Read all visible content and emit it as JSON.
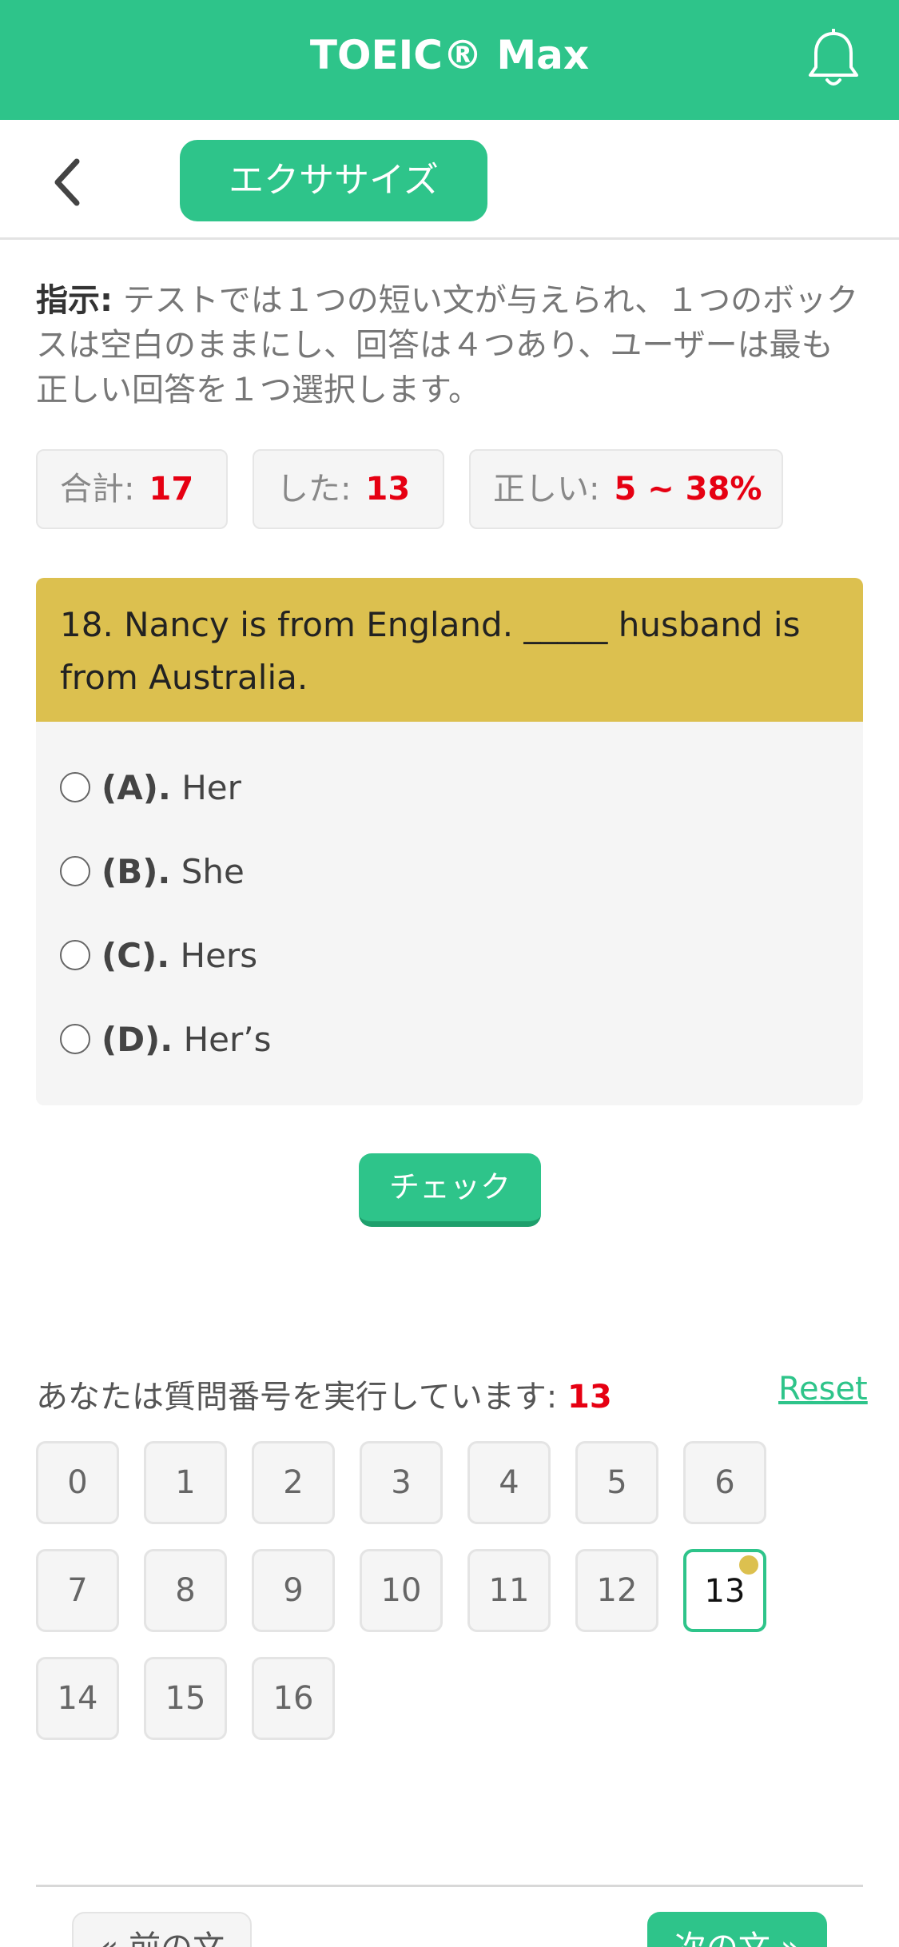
{
  "header": {
    "title": "TOEIC® Max",
    "bell_icon": "bell-icon"
  },
  "subbar": {
    "back_icon": "chevron-left-icon",
    "tab_label": "エクササイズ"
  },
  "instruction": {
    "label": "指示:",
    "text": " テストでは１つの短い文が与えられ、１つのボックスは空白のままにし、回答は４つあり、ユーザーは最も正しい回答を１つ選択します。"
  },
  "stats": {
    "total_label": "合計:",
    "total_value": "17",
    "done_label": "した:",
    "done_value": "13",
    "correct_label": "正しい:",
    "correct_value": "5 ~ 38%"
  },
  "question": {
    "text": "18. Nancy is from England. _____ husband is from Australia.",
    "options": [
      {
        "key": "(A).",
        "text": " Her"
      },
      {
        "key": "(B).",
        "text": " She"
      },
      {
        "key": "(C).",
        "text": " Hers"
      },
      {
        "key": "(D).",
        "text": " Her’s"
      }
    ]
  },
  "check_label": "チェック",
  "progress": {
    "label": "あなたは質問番号を実行しています: ",
    "current": "13",
    "reset_label": "Reset"
  },
  "numbers": [
    "0",
    "1",
    "2",
    "3",
    "4",
    "5",
    "6",
    "7",
    "8",
    "9",
    "10",
    "11",
    "12",
    "13",
    "14",
    "15",
    "16"
  ],
  "active_number": "13",
  "nav": {
    "prev_label": "« 前の文",
    "next_label": "次の文 »"
  },
  "colors": {
    "primary": "#2ec48a",
    "question_bg": "#dcc04f",
    "highlight": "#e60012"
  }
}
